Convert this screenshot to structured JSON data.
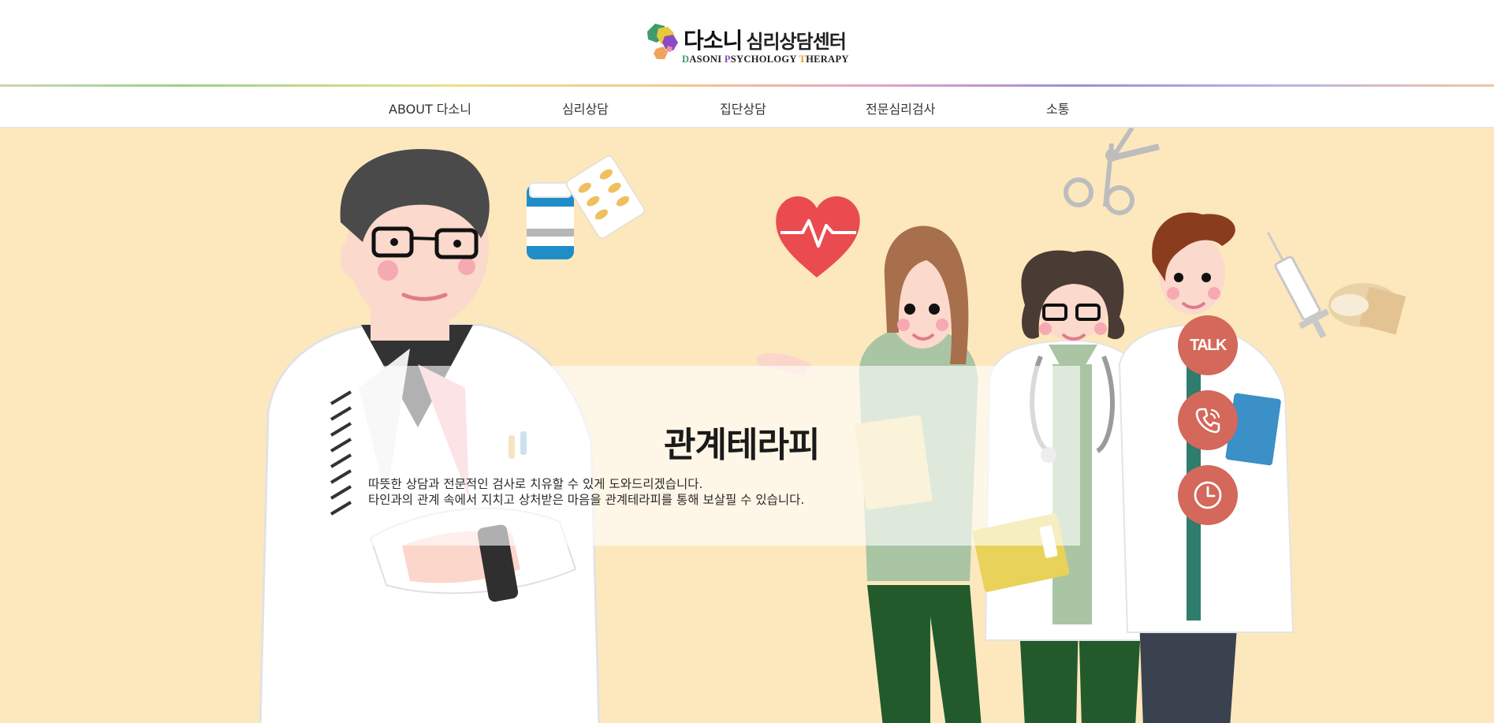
{
  "logo": {
    "main": "다소니",
    "sub": "심리상담센터",
    "eng_d": "D",
    "eng_1": "ASONI ",
    "eng_p": "P",
    "eng_2": "SYCHOLOGY ",
    "eng_t": "T",
    "eng_3": "HERAPY"
  },
  "nav": {
    "items": [
      {
        "label": "ABOUT 다소니"
      },
      {
        "label": "심리상담"
      },
      {
        "label": "집단상담"
      },
      {
        "label": "전문심리검사"
      },
      {
        "label": "소통"
      }
    ]
  },
  "hero": {
    "title": "관계테라피",
    "line1": "따뜻한 상담과 전문적인 검사로 치유할 수 있게 도와드리겠습니다.",
    "line2": "타인과의 관계 속에서 지치고 상처받은 마음을 관계테라피를 통해 보살필 수 있습니다."
  },
  "floating": {
    "talk_label": "TALK",
    "call_icon": "phone-icon",
    "time_icon": "clock-icon"
  },
  "colors": {
    "hero_bg": "#fde8bd",
    "fab": "#d3685b",
    "lab_coat": "#ffffff",
    "scrubs": "#225a2c"
  }
}
